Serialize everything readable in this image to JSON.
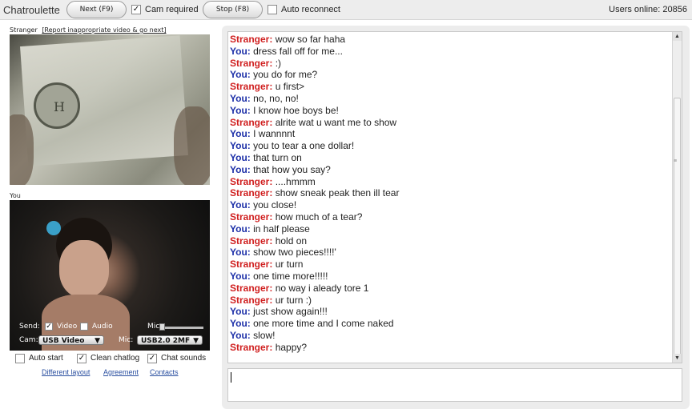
{
  "topbar": {
    "brand": "Chatroulette",
    "next_label": "Next (F9)",
    "stop_label": "Stop (F8)",
    "cam_required_label": "Cam required",
    "cam_required_checked": true,
    "auto_reconnect_label": "Auto reconnect",
    "auto_reconnect_checked": false,
    "users_online": "Users online: 20856"
  },
  "stranger_panel": {
    "label": "Stranger",
    "report_link": "[Report inappropriate video & go next]"
  },
  "you_panel": {
    "label": "You",
    "send_label": "Send:",
    "video_label": "Video",
    "video_checked": true,
    "audio_label": "Audio",
    "audio_checked": false,
    "mic_slider_label": "Mic:",
    "cam_label": "Cam:",
    "cam_value": "USB Video",
    "mic_label": "Mic:",
    "mic_value": "USB2.0 2MF"
  },
  "options": {
    "auto_start": {
      "label": "Auto start",
      "checked": false
    },
    "clean_chatlog": {
      "label": "Clean chatlog",
      "checked": true
    },
    "chat_sounds": {
      "label": "Chat sounds",
      "checked": true
    }
  },
  "footer_links": {
    "different_layout": "Different layout",
    "agreement": "Agreement",
    "contacts": "Contacts"
  },
  "chat": {
    "messages": [
      {
        "who": "Stranger:",
        "text": "wow so far haha"
      },
      {
        "who": "You:",
        "text": "dress fall off for me..."
      },
      {
        "who": "Stranger:",
        "text": ":)"
      },
      {
        "who": "You:",
        "text": "you do for me?"
      },
      {
        "who": "Stranger:",
        "text": "u first>"
      },
      {
        "who": "You:",
        "text": "no, no, no!"
      },
      {
        "who": "You:",
        "text": "I know hoe boys be!"
      },
      {
        "who": "Stranger:",
        "text": "alrite wat u want me to show"
      },
      {
        "who": "You:",
        "text": "I wannnnt"
      },
      {
        "who": "You:",
        "text": "you to tear a one dollar!"
      },
      {
        "who": "You:",
        "text": "that turn on"
      },
      {
        "who": "You:",
        "text": "that how you say?"
      },
      {
        "who": "Stranger:",
        "text": "....hmmm"
      },
      {
        "who": "Stranger:",
        "text": "show sneak peak then ill tear"
      },
      {
        "who": "You:",
        "text": "you close!"
      },
      {
        "who": "Stranger:",
        "text": "how much of a tear?"
      },
      {
        "who": "You:",
        "text": "in half please"
      },
      {
        "who": "Stranger:",
        "text": "hold on"
      },
      {
        "who": "You:",
        "text": "show two pieces!!!!'"
      },
      {
        "who": "Stranger:",
        "text": "ur turn"
      },
      {
        "who": "You:",
        "text": "one time more!!!!!"
      },
      {
        "who": "Stranger:",
        "text": "no way i aleady tore 1"
      },
      {
        "who": "Stranger:",
        "text": "ur turn :)"
      },
      {
        "who": "You:",
        "text": "just show again!!!"
      },
      {
        "who": "You:",
        "text": "one more time and I come naked"
      },
      {
        "who": "You:",
        "text": "slow!"
      },
      {
        "who": "Stranger:",
        "text": "happy?"
      }
    ],
    "input_value": ""
  },
  "colors": {
    "stranger": "#d02020",
    "you": "#1c2fa8"
  }
}
